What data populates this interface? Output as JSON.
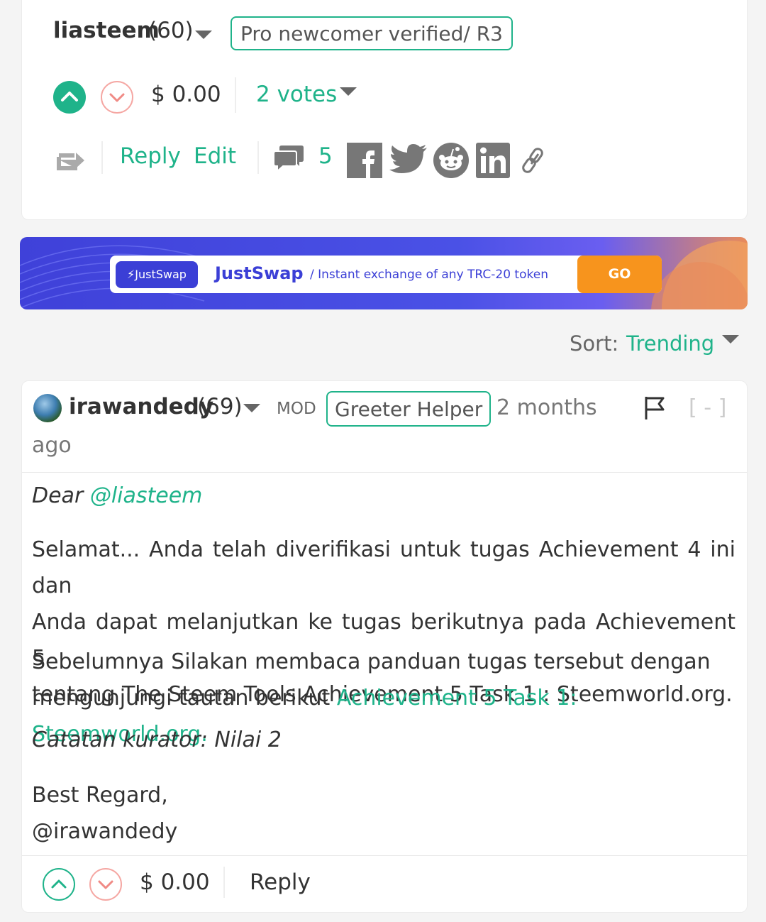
{
  "post": {
    "author": "liasteem",
    "reputation": "(60)",
    "badge": "Pro newcomer verified/ R3",
    "payout": "$ 0.00",
    "votes": "2 votes",
    "reply": "Reply",
    "edit": "Edit",
    "comment_count": "5"
  },
  "ad": {
    "logo": "JustSwap",
    "title": "JustSwap",
    "tagline": "/ Instant exchange of any TRC-20 token",
    "cta": "GO"
  },
  "sort": {
    "label": "Sort:",
    "value": "Trending"
  },
  "comment": {
    "author": "irawandedy",
    "reputation": "(69)",
    "mod": "MOD",
    "badge": "Greeter Helper",
    "time_line1": "2 months",
    "time_line2": "ago",
    "collapse": "[ - ]",
    "dear": "Dear ",
    "mention": "@liasteem",
    "para1_line1": "Selamat... Anda telah diverifikasi untuk tugas Achievement 4 ini dan",
    "para1_line2": "Anda dapat melanjutkan ke tugas berikutnya pada Achievement 5",
    "para1_line3": "tentang The Steem Tools Achievement 5 Task 1 : Steemworld.org.",
    "para2_line1": "Sebelumnya Silakan membaca panduan tugas tersebut dengan",
    "para2_line2": "mengunjungi tautan berikut ",
    "para2_link": "Achievement 5 Task 1: Steemworld.org.",
    "curator_note": "Catatan kurator: Nilai 2",
    "regards": "Best Regard,",
    "signature": "@irawandedy",
    "payout": "$ 0.00",
    "reply": "Reply"
  },
  "colors": {
    "accent": "#1fb38a",
    "downvote": "#f5a7a3",
    "banner_blue": "#3f41d9",
    "banner_orange": "#f59b1c"
  }
}
